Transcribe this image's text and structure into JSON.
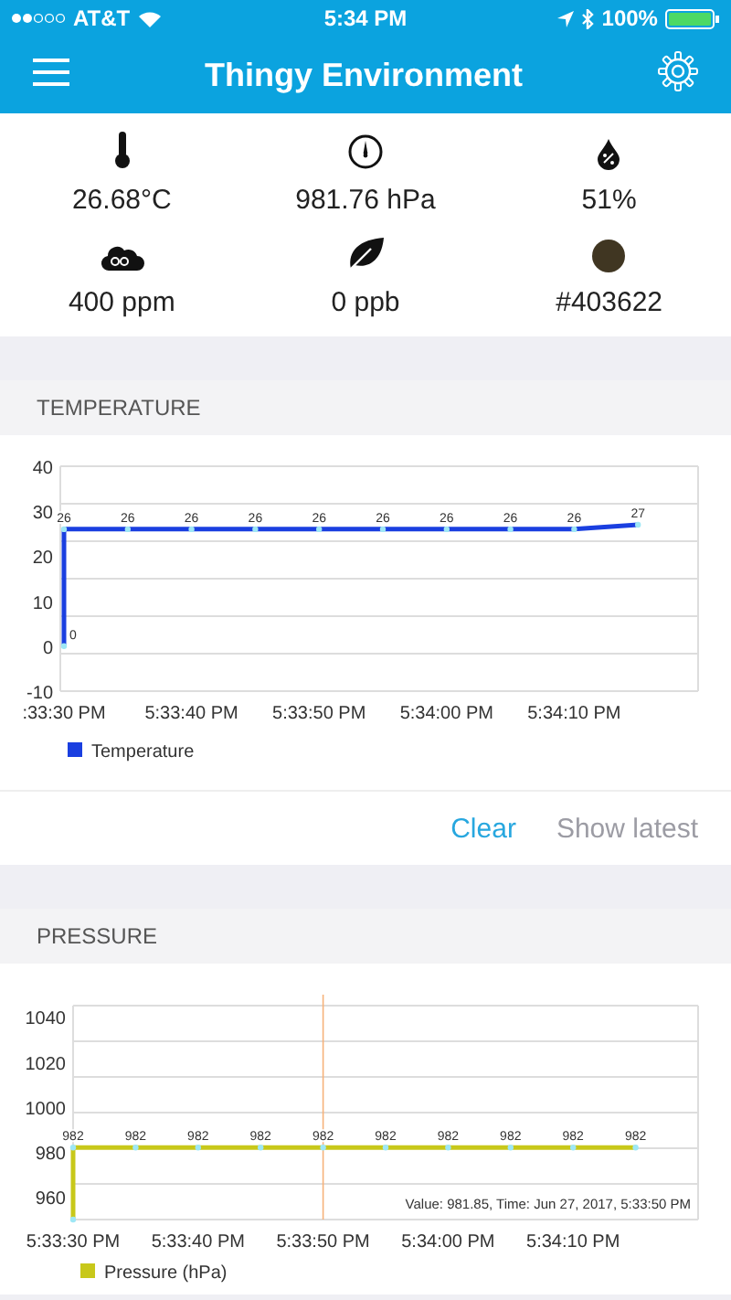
{
  "status_bar": {
    "carrier": "AT&T",
    "time": "5:34 PM",
    "battery": "100%"
  },
  "nav_bar": {
    "title": "Thingy Environment"
  },
  "sensors": [
    {
      "kind": "thermometer",
      "value": "26.68°C"
    },
    {
      "kind": "gauge",
      "value": "981.76 hPa"
    },
    {
      "kind": "humidity",
      "value": "51%"
    },
    {
      "kind": "co2",
      "value": "400 ppm"
    },
    {
      "kind": "leaf",
      "value": "0 ppb"
    },
    {
      "kind": "color",
      "value": "#403622",
      "color": "#403622"
    }
  ],
  "sections": [
    {
      "title": "TEMPERATURE",
      "chart_data": {
        "type": "line",
        "categories": [
          ":33:30 PM",
          null,
          "5:33:40 PM",
          null,
          "5:33:50 PM",
          null,
          "5:34:00 PM",
          null,
          "5:34:10 PM",
          null
        ],
        "series": [
          {
            "name": "Temperature",
            "color": "#1a3fe0",
            "marker": "circle",
            "values": [
              26,
              26,
              26,
              26,
              26,
              26,
              26,
              26,
              26,
              27
            ]
          }
        ],
        "annotations": [
          {
            "x": ":33:30 PM",
            "y": 0,
            "text": "0"
          }
        ],
        "ylim": [
          -10,
          40
        ],
        "yticks": [
          -10,
          0,
          10,
          20,
          30,
          40
        ],
        "data_labels": true
      },
      "buttons": [
        {
          "label": "Clear",
          "disabled": false
        },
        {
          "label": "Show latest",
          "disabled": true
        }
      ]
    },
    {
      "title": "PRESSURE",
      "chart_data": {
        "type": "line",
        "categories": [
          "5:33:30 PM",
          null,
          "5:33:40 PM",
          null,
          "5:33:50 PM",
          null,
          "5:34:00 PM",
          null,
          "5:34:10 PM",
          null
        ],
        "series": [
          {
            "name": "Pressure (hPa)",
            "color": "#c8c81a",
            "marker": "circle",
            "values": [
              982,
              982,
              982,
              982,
              982,
              982,
              982,
              982,
              982,
              982
            ]
          }
        ],
        "ylim": [
          950,
          1045
        ],
        "yticks": [
          960,
          980,
          1000,
          1020,
          1040
        ],
        "data_labels": true,
        "ref_lines": [
          {
            "axis": "x",
            "value": "5:33:50 PM",
            "color": "#f6b27a"
          }
        ],
        "annotations": [
          {
            "x": "5:33:30 PM"
          },
          "Value: 981.85, Time: Jun 27, 2017, 5:33:50 PM"
        ]
      }
    }
  ]
}
